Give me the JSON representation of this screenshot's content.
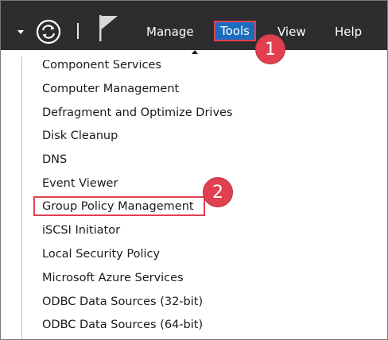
{
  "menubar": {
    "items": {
      "manage": "Manage",
      "tools": "Tools",
      "view": "View",
      "help": "Help"
    },
    "icons": [
      "dropdown-arrow-icon",
      "refresh-icon",
      "flag-icon"
    ]
  },
  "markers": {
    "one": "1",
    "two": "2"
  },
  "tools_menu": {
    "items": [
      "Component Services",
      "Computer Management",
      "Defragment and Optimize Drives",
      "Disk Cleanup",
      "DNS",
      "Event Viewer",
      "Group Policy Management",
      "iSCSI Initiator",
      "Local Security Policy",
      "Microsoft Azure Services",
      "ODBC Data Sources (32-bit)",
      "ODBC Data Sources (64-bit)"
    ],
    "highlighted": "Group Policy Management"
  },
  "colors": {
    "menubar_bg": "#2d2d30",
    "tools_active_bg": "#1c6dc0",
    "annotation_red": "#e0404f"
  }
}
